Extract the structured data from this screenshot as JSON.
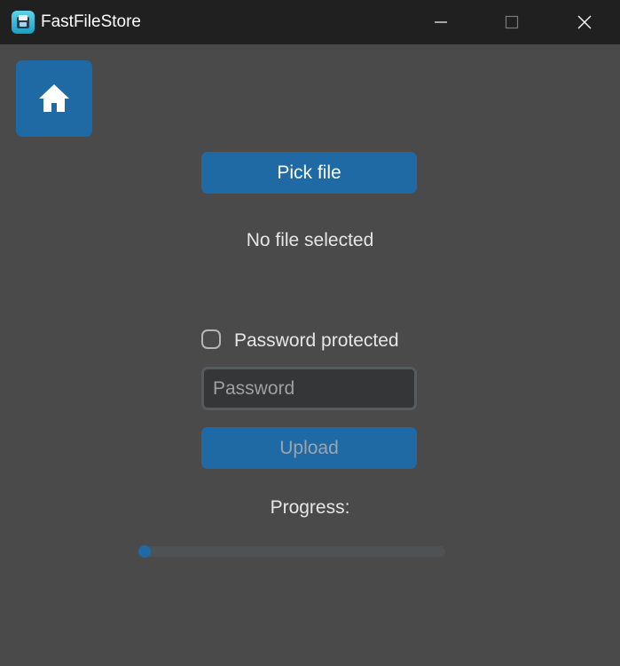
{
  "window": {
    "title": "FastFileStore",
    "app_icon": "app-icon",
    "controls": {
      "minimize_icon": "minimize-icon",
      "maximize_icon": "maximize-icon",
      "close_icon": "close-icon"
    }
  },
  "nav": {
    "home_icon": "home-icon"
  },
  "main": {
    "pick_button_label": "Pick file",
    "file_status": "No file selected",
    "password_checkbox": {
      "label": "Password protected",
      "checked": false
    },
    "password_input": {
      "value": "",
      "placeholder": "Password"
    },
    "upload_button_label": "Upload",
    "progress_label": "Progress:",
    "progress_value": 0
  },
  "colors": {
    "accent": "#1f6aa5",
    "background": "#4a4a4a",
    "titlebar": "#202020",
    "input_bg": "#343638"
  }
}
